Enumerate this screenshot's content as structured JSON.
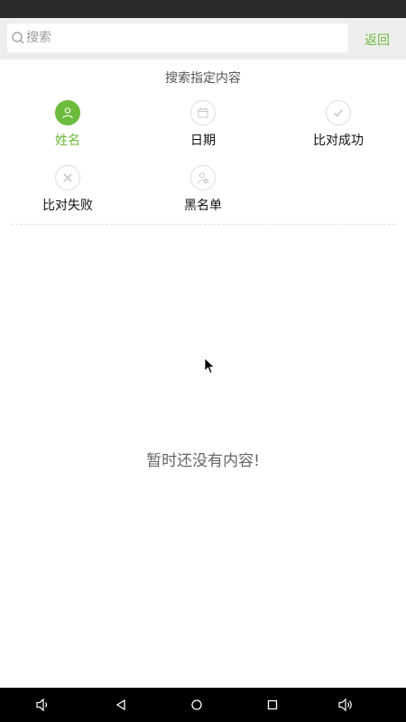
{
  "search": {
    "placeholder": "搜索",
    "value": "",
    "back_label": "返回"
  },
  "section_title": "搜索指定内容",
  "filters": [
    {
      "label": "姓名",
      "icon": "person-icon",
      "active": true
    },
    {
      "label": "日期",
      "icon": "calendar-icon",
      "active": false
    },
    {
      "label": "比对成功",
      "icon": "check-icon",
      "active": false
    },
    {
      "label": "比对失败",
      "icon": "cross-icon",
      "active": false
    },
    {
      "label": "黑名单",
      "icon": "person-block-icon",
      "active": false
    }
  ],
  "empty_message": "暂时还没有内容!",
  "navbar": {
    "buttons": [
      "volume-down-icon",
      "back-icon",
      "home-icon",
      "recents-icon",
      "volume-up-icon"
    ]
  },
  "colors": {
    "accent": "#6cbb3c",
    "status_bar": "#2a2a2a",
    "nav_bar": "#000000",
    "search_bar_bg": "#eeeeee"
  }
}
